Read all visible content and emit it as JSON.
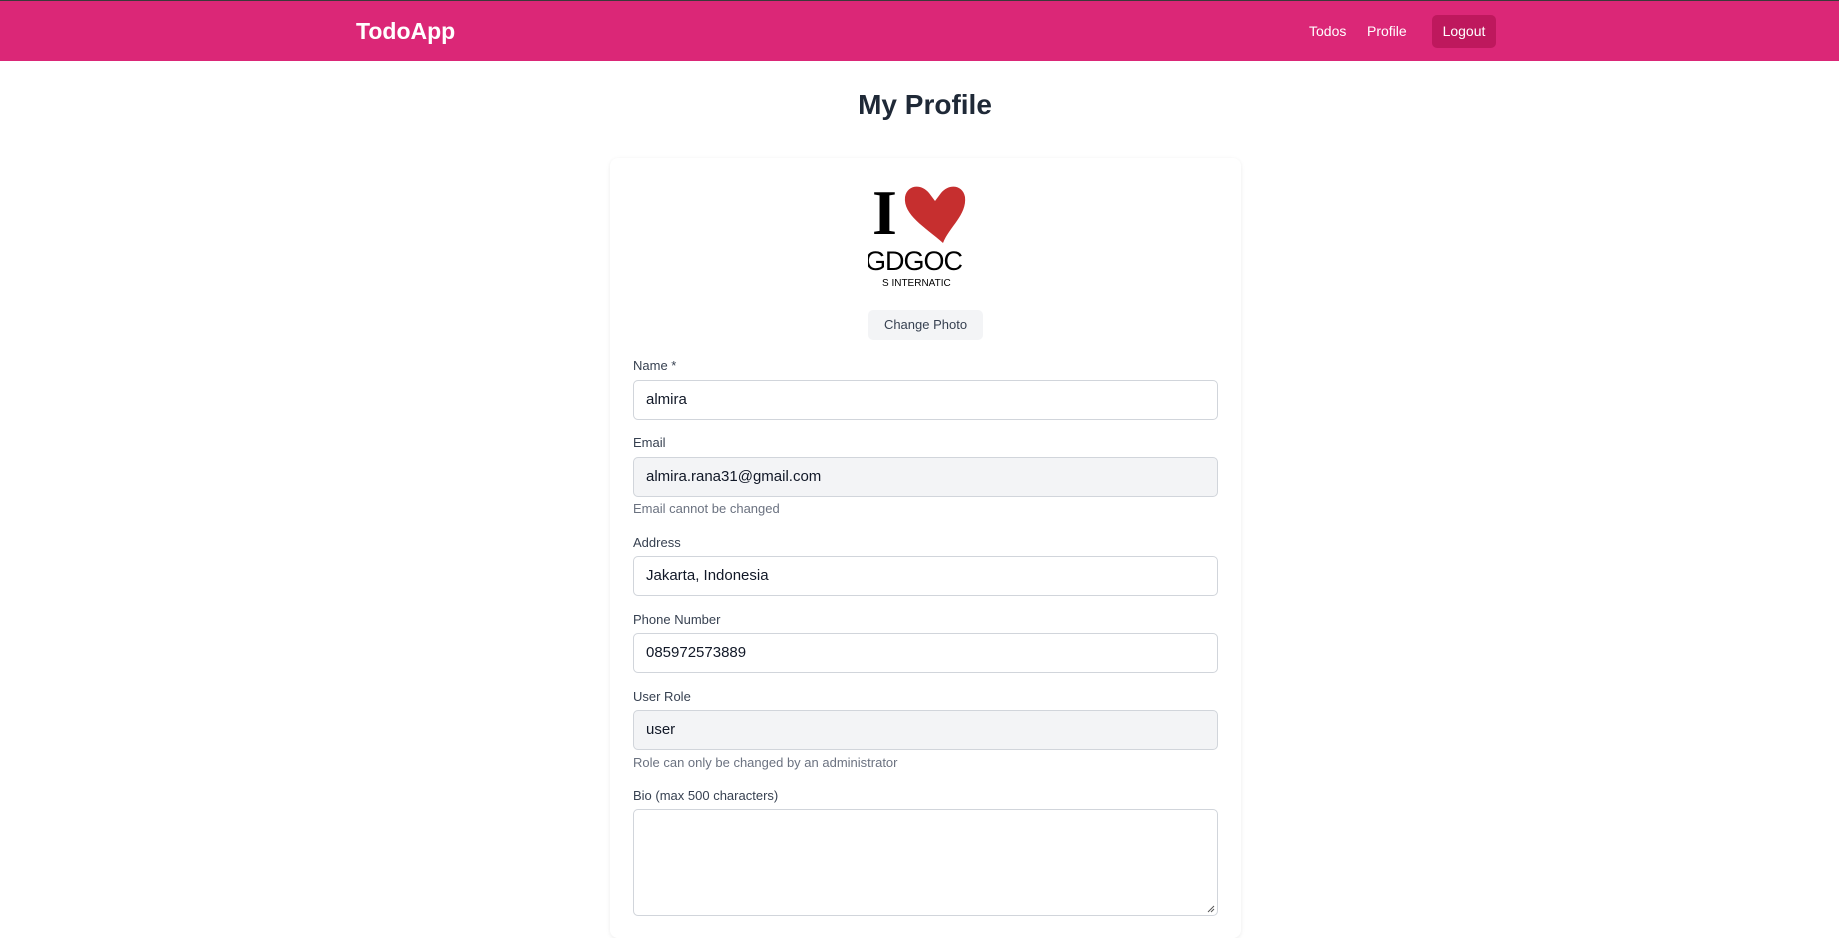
{
  "nav": {
    "brand": "TodoApp",
    "links": [
      "Todos",
      "Profile"
    ],
    "logout": "Logout"
  },
  "page": {
    "title": "My Profile"
  },
  "avatar": {
    "line1": "I",
    "line2": "GDGOC",
    "line3": "S INTERNATIC"
  },
  "change_photo_label": "Change Photo",
  "form": {
    "name": {
      "label": "Name *",
      "value": "almira"
    },
    "email": {
      "label": "Email",
      "value": "almira.rana31@gmail.com",
      "help": "Email cannot be changed"
    },
    "address": {
      "label": "Address",
      "value": "Jakarta, Indonesia"
    },
    "phone": {
      "label": "Phone Number",
      "value": "085972573889"
    },
    "role": {
      "label": "User Role",
      "value": "user",
      "help": "Role can only be changed by an administrator"
    },
    "bio": {
      "label": "Bio (max 500 characters)",
      "value": ""
    }
  },
  "colors": {
    "navbar": "#db2777",
    "logout_bg": "#be185d",
    "disabled_bg": "#f3f4f6"
  }
}
